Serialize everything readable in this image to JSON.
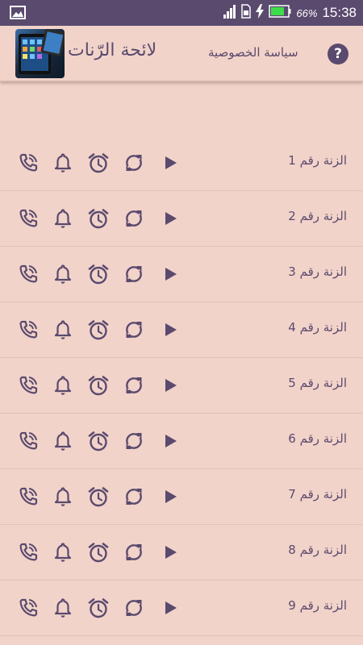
{
  "status_bar": {
    "battery": "66%",
    "time": "15:38"
  },
  "app_bar": {
    "title": "لائحة الرّنات",
    "privacy_link": "سياسة الخصوصية",
    "help_symbol": "?"
  },
  "ringtones": [
    {
      "label": "الزنة رقم 1"
    },
    {
      "label": "الزنة رقم 2"
    },
    {
      "label": "الزنة رقم 3"
    },
    {
      "label": "الزنة رقم 4"
    },
    {
      "label": "الزنة رقم 5"
    },
    {
      "label": "الزنة رقم 6"
    },
    {
      "label": "الزنة رقم 7"
    },
    {
      "label": "الزنة رقم 8"
    },
    {
      "label": "الزنة رقم 9"
    }
  ],
  "colors": {
    "background": "#f2d3c9",
    "accent": "#5a4a6e"
  }
}
